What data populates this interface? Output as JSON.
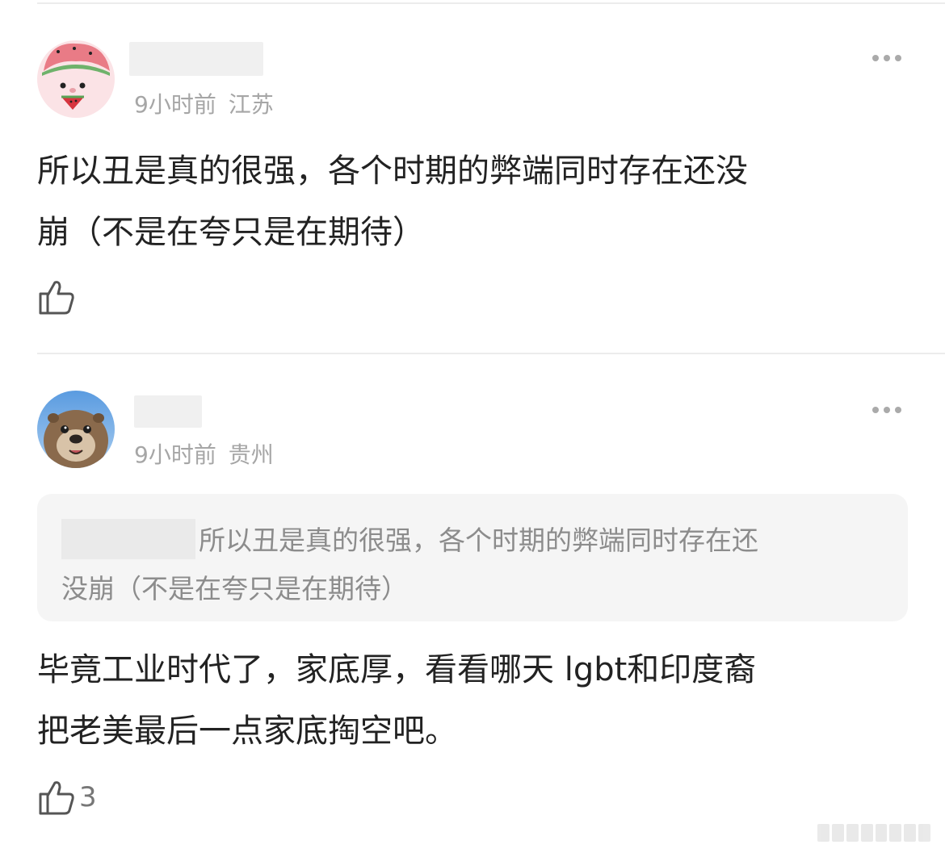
{
  "comments": [
    {
      "time": "9小时前",
      "location": "江苏",
      "text_line1": "所以丑是真的很强，各个时期的弊端同时存在还没",
      "text_line2": "崩（不是在夸只是在期待）",
      "likes": ""
    },
    {
      "time": "9小时前",
      "location": "贵州",
      "quote_line1": "所以丑是真的很强，各个时期的弊端同时存在还",
      "quote_line2": "没崩（不是在夸只是在期待）",
      "text_line1": "毕竟工业时代了，家底厚，看看哪天 lgbt和印度裔",
      "text_line2": "把老美最后一点家底掏空吧。",
      "likes": "3"
    }
  ],
  "icons": {
    "more": "more-horizontal-icon",
    "like": "thumbs-up-icon",
    "avatar1": "pink-watermelon-character",
    "avatar2": "otter-photo"
  }
}
